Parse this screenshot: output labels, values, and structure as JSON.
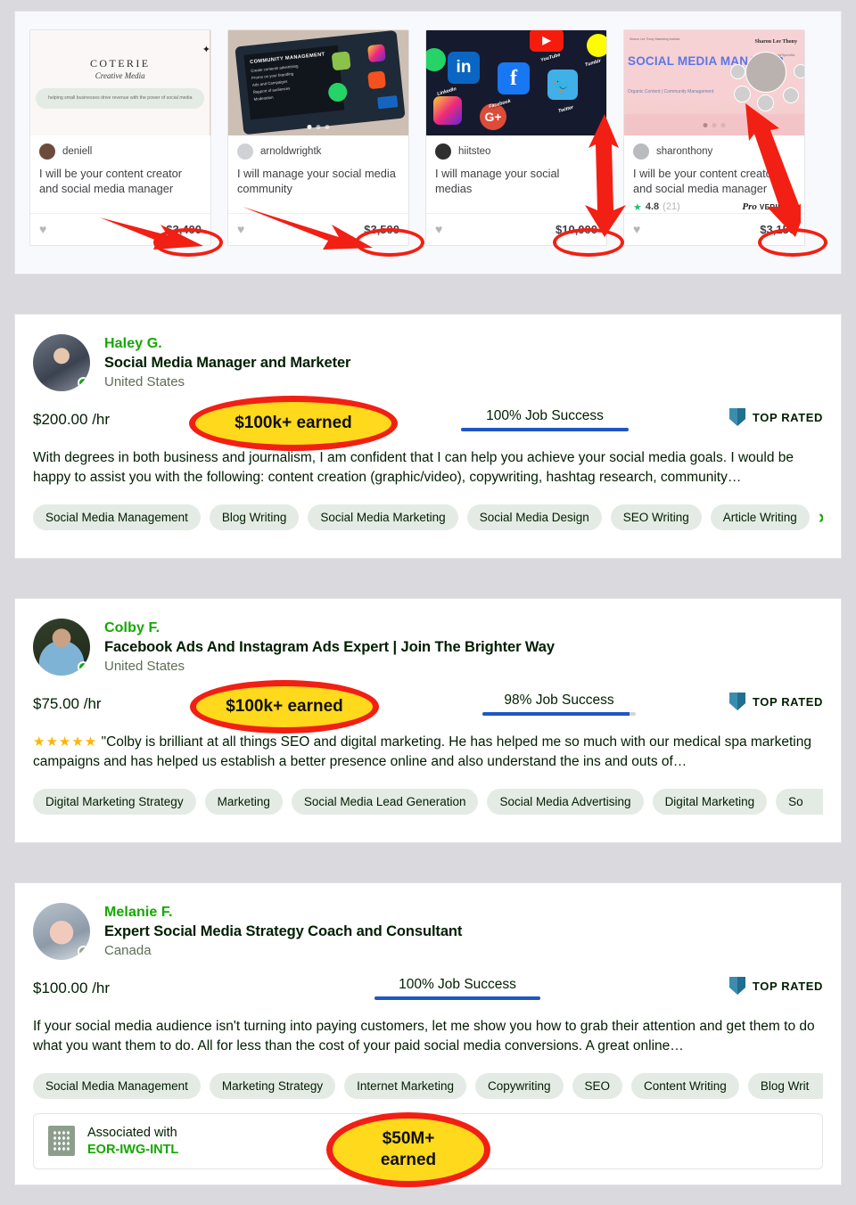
{
  "gigs": [
    {
      "username": "deniell",
      "title": "I will be your content creator and social media manager",
      "price": "$3,400",
      "thumb_brand": "COTERIE",
      "thumb_script": "Creative Media",
      "thumb_tagline": "helping small businesses drive revenue with the power of social media",
      "heart_icon": "heart-icon"
    },
    {
      "username": "arnoldwrightk",
      "title": "I will manage your social media community",
      "price": "$3,500",
      "thumb_heading": "COMMUNITY MANAGEMENT",
      "thumb_lines": [
        "Create contents advertising",
        "Promo on your branding",
        "Ads and Campaigns",
        "Rapport of audiences",
        "Moderation"
      ],
      "heart_icon": "heart-icon"
    },
    {
      "username": "hiitsteo",
      "title": "I will manage your social medias",
      "price": "$10,000",
      "thumb_labels": [
        "LinkedIn",
        "Facebook",
        "Twitter",
        "YouTube",
        "Tumblr",
        "G+"
      ],
      "heart_icon": "heart-icon"
    },
    {
      "username": "sharonthony",
      "title": "I will be your content creator and social media manager",
      "price": "$3,150",
      "rating": "4.8",
      "rating_count": "(21)",
      "pro_label": "Pro",
      "verified_label": "VERIFIED",
      "thumb_title": "SOCIAL MEDIA MANAGER",
      "thumb_sub": "Organic Content | Community Management",
      "thumb_micro": "Sharon Lee Thony Marketing Institute",
      "thumb_person": "Sharon Lee Thony",
      "thumb_person_sub": "Founder & Digital Specialist",
      "heart_icon": "heart-icon"
    }
  ],
  "freelancers": [
    {
      "name": "Haley G.",
      "role": "Social Media Manager and Marketer",
      "location": "United States",
      "rate": "$200.00",
      "rate_unit": "/hr",
      "job_success": "100% Job Success",
      "job_success_pct": 100,
      "top_rated": "TOP RATED",
      "description": "With degrees in both business and journalism, I am confident that I can help you achieve your social media goals. I would be happy to assist you with the following: content creation (graphic/video), copywriting, hashtag research, community…",
      "tags": [
        "Social Media Management",
        "Blog Writing",
        "Social Media Marketing",
        "Social Media Design",
        "SEO Writing",
        "Article Writing"
      ],
      "status": "online",
      "annotation": "$100k+ earned"
    },
    {
      "name": "Colby F.",
      "role": "Facebook Ads And Instagram Ads Expert | Join The Brighter Way",
      "location": "United States",
      "rate": "$75.00",
      "rate_unit": "/hr",
      "job_success": "98% Job Success",
      "job_success_pct": 98,
      "top_rated": "TOP RATED",
      "stars": "★★★★★",
      "description": "\"Colby is brilliant at all things SEO and digital marketing. He has helped me so much with our medical spa marketing campaigns and has helped us establish a better presence online and also understand the ins and outs of…",
      "tags": [
        "Digital Marketing Strategy",
        "Marketing",
        "Social Media Lead Generation",
        "Social Media Advertising",
        "Digital Marketing",
        "So"
      ],
      "status": "online",
      "annotation": "$100k+ earned"
    },
    {
      "name": "Melanie F.",
      "role": "Expert Social Media Strategy Coach and Consultant",
      "location": "Canada",
      "rate": "$100.00",
      "rate_unit": "/hr",
      "job_success": "100% Job Success",
      "job_success_pct": 100,
      "top_rated": "TOP RATED",
      "description": "If your social media audience isn't turning into paying customers, let me show you how to grab their attention and get them to do what you want them to do. All for less than the cost of your paid social media conversions. A great online…",
      "tags": [
        "Social Media Management",
        "Marketing Strategy",
        "Internet Marketing",
        "Copywriting",
        "SEO",
        "Content Writing",
        "Blog Writ"
      ],
      "status": "offline",
      "associated_label": "Associated with",
      "associated_company": "EOR-IWG-INTL",
      "annotation_line1": "$50M+",
      "annotation_line2": "earned"
    }
  ],
  "colors": {
    "highlight_fill": "#ffd91c",
    "highlight_stroke": "#f21f14",
    "arrow": "#f21f14",
    "brand_green": "#14a800",
    "job_success_bar": "#1f57c3",
    "top_rated_badge": "#3c8dad",
    "tag_bg": "#e4ebe4",
    "page_bg": "#d9d9de"
  },
  "icons": {
    "chevron_right": "›",
    "heart": "♥",
    "star": "★",
    "shield": "shield-icon",
    "building": "building-icon"
  }
}
